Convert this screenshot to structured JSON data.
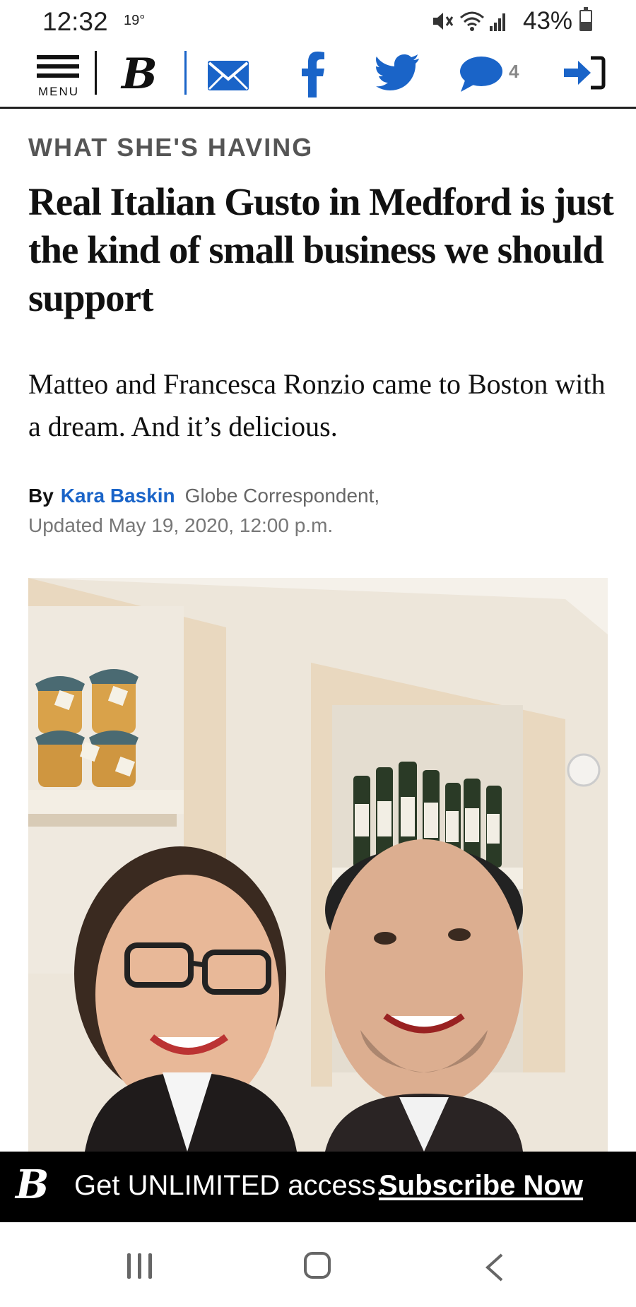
{
  "status_bar": {
    "time": "12:32",
    "temperature": "19°",
    "battery": "43%",
    "battery_level": 0.43
  },
  "nav": {
    "menu_label": "MENU",
    "logo": "B",
    "comment_count": "4",
    "icons": [
      "menu-icon",
      "boston-globe-logo",
      "email-icon",
      "facebook-icon",
      "twitter-icon",
      "comment-icon",
      "login-icon"
    ],
    "colors": {
      "accent": "#1a64c8",
      "text": "#111111"
    }
  },
  "article": {
    "kicker": "WHAT SHE'S HAVING",
    "headline": "Real Italian Gusto in Medford is just the kind of small business we should support",
    "dek": "Matteo and Francesca Ronzio came to Boston with a dream. And it’s delicious.",
    "byline": {
      "by": "By",
      "author": "Kara Baskin",
      "role": "Globe Correspondent,",
      "updated": "Updated May 19, 2020, 12:00 p.m."
    }
  },
  "banner": {
    "logo": "B",
    "text": "Get UNLIMITED access.",
    "link": "Subscribe Now"
  }
}
